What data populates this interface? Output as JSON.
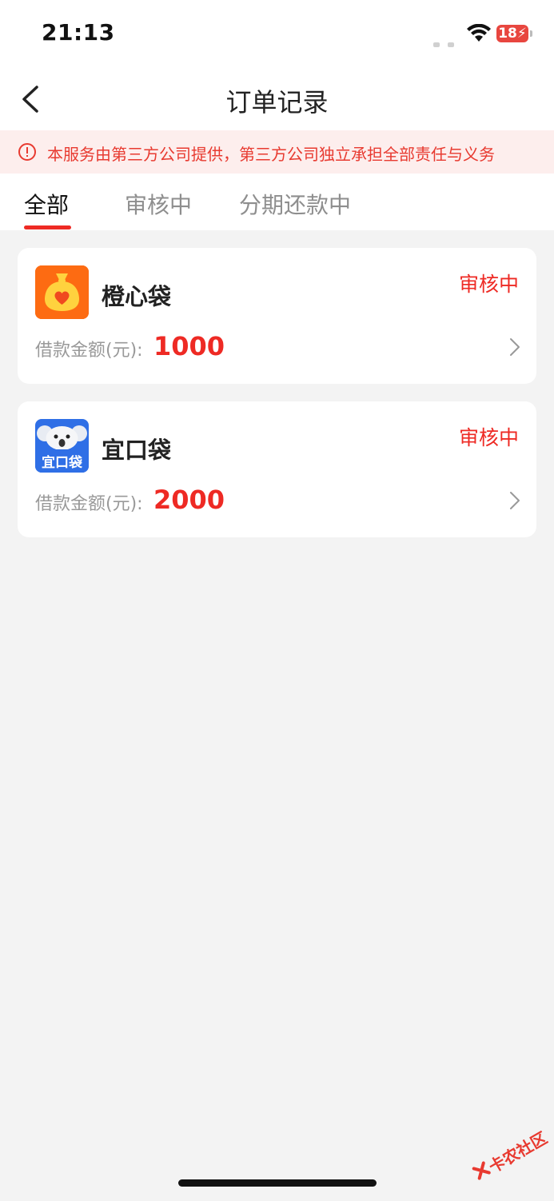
{
  "status_bar": {
    "time": "21:13",
    "battery": "18"
  },
  "navbar": {
    "title": "订单记录",
    "back_icon": "chevron-left-icon"
  },
  "notice": {
    "text": "本服务由第三方公司提供，第三方公司独立承担全部责任与义务",
    "icon": "alert-circle-icon",
    "color": "#e83a30"
  },
  "tabs": [
    {
      "label": "全部",
      "active": true
    },
    {
      "label": "审核中",
      "active": false
    },
    {
      "label": "分期还款中",
      "active": false
    }
  ],
  "orders": [
    {
      "name": "橙心袋",
      "status": "审核中",
      "amount_label": "借款金额(元):",
      "amount": "1000",
      "logo": "money-bag-heart-icon"
    },
    {
      "name": "宜口袋",
      "status": "审核中",
      "amount_label": "借款金额(元):",
      "amount": "2000",
      "logo": "koala-icon",
      "logo_text": "宜口袋"
    }
  ],
  "watermark": {
    "text": "卡农社区"
  },
  "colors": {
    "accent": "#ee2a24",
    "background": "#f3f3f3",
    "card": "#ffffff"
  }
}
